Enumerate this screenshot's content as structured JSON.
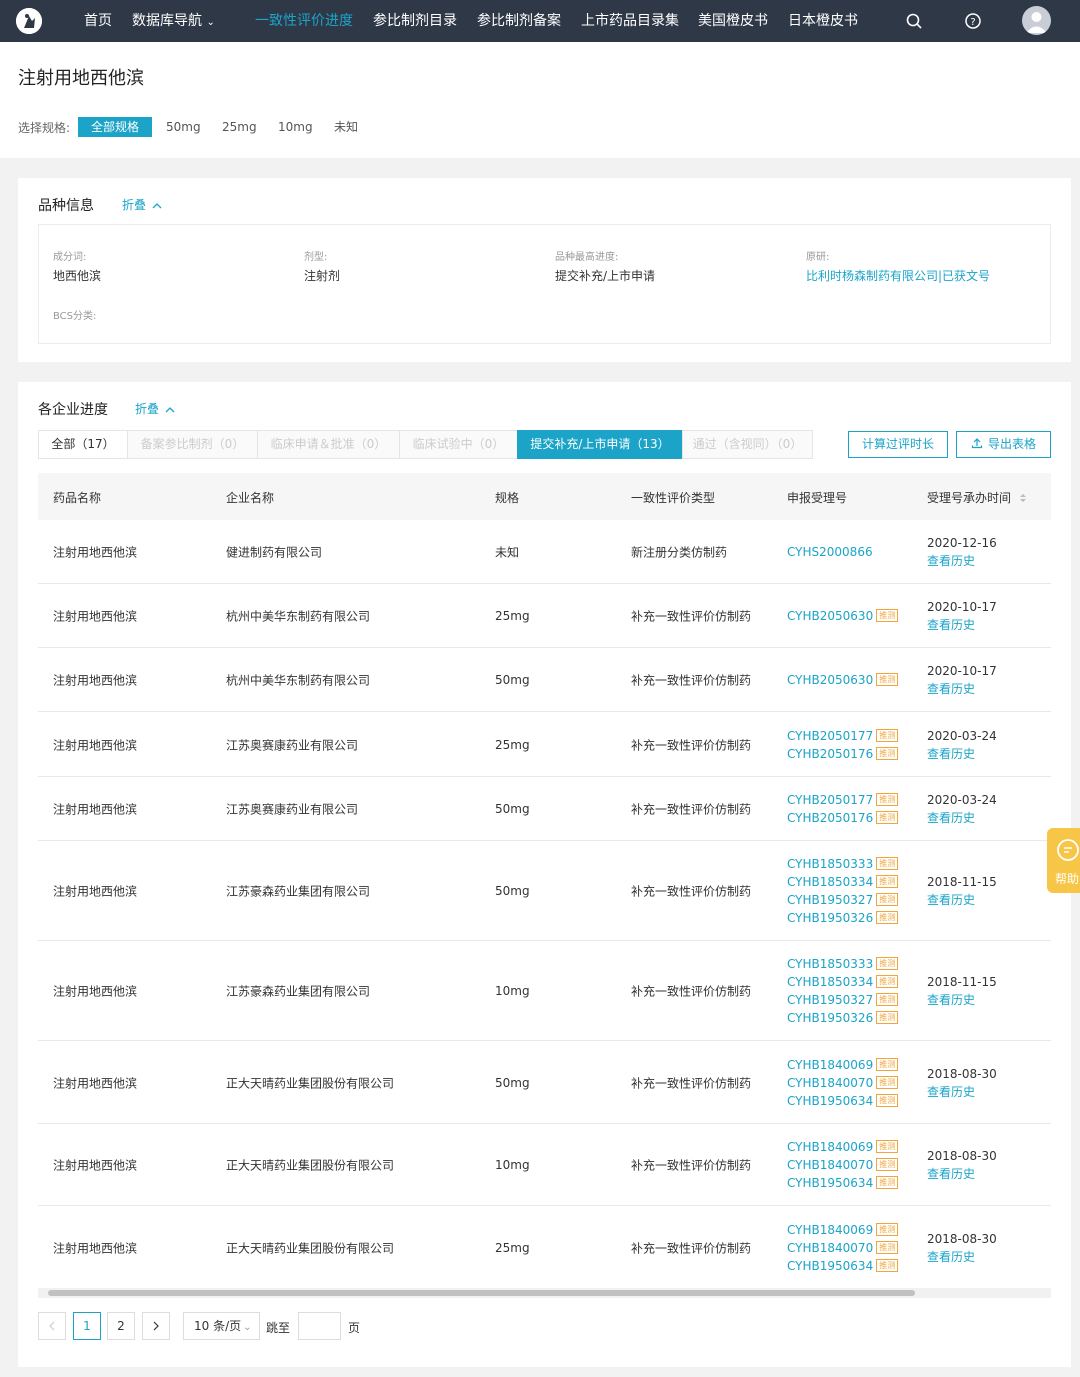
{
  "nav": {
    "items": [
      "首页",
      "数据库导航",
      "一致性评价进度",
      "参比制剂目录",
      "参比制剂备案",
      "上市药品目录集",
      "美国橙皮书",
      "日本橙皮书"
    ],
    "active_index": 2
  },
  "header": {
    "title": "注射用地西他滨",
    "spec_label": "选择规格:",
    "specs": [
      "全部规格",
      "50mg",
      "25mg",
      "10mg",
      "未知"
    ]
  },
  "variety": {
    "title": "品种信息",
    "fold": "折叠",
    "fields": [
      {
        "label": "成分词:",
        "value": "地西他滨"
      },
      {
        "label": "剂型:",
        "value": "注射剂"
      },
      {
        "label": "品种最高进度:",
        "value": "提交补充/上市申请"
      },
      {
        "label": "原研:",
        "value": "比利时杨森制药有限公司|已获文号"
      },
      {
        "label": "BCS分类:",
        "value": ""
      }
    ]
  },
  "progress": {
    "title": "各企业进度",
    "fold": "折叠",
    "tabs": [
      "全部（17）",
      "备案参比制剂（0）",
      "临床申请＆批准（0）",
      "临床试验中（0）",
      "提交补充/上市申请（13）",
      "通过（含视同）（0）"
    ],
    "calc_btn": "计算过评时长",
    "export_btn": "导出表格",
    "columns": [
      "药品名称",
      "企业名称",
      "规格",
      "一致性评价类型",
      "申报受理号",
      "受理号承办时间"
    ],
    "tag": "推测",
    "history": "查看历史",
    "rows": [
      {
        "drug": "注射用地西他滨",
        "company": "健进制药有限公司",
        "spec": "未知",
        "type": "新注册分类仿制药",
        "acc": [
          "CYHS2000866"
        ],
        "tagged": false,
        "date": "2020-12-16"
      },
      {
        "drug": "注射用地西他滨",
        "company": "杭州中美华东制药有限公司",
        "spec": "25mg",
        "type": "补充一致性评价仿制药",
        "acc": [
          "CYHB2050630"
        ],
        "tagged": true,
        "date": "2020-10-17"
      },
      {
        "drug": "注射用地西他滨",
        "company": "杭州中美华东制药有限公司",
        "spec": "50mg",
        "type": "补充一致性评价仿制药",
        "acc": [
          "CYHB2050630"
        ],
        "tagged": true,
        "date": "2020-10-17"
      },
      {
        "drug": "注射用地西他滨",
        "company": "江苏奥赛康药业有限公司",
        "spec": "25mg",
        "type": "补充一致性评价仿制药",
        "acc": [
          "CYHB2050177",
          "CYHB2050176"
        ],
        "tagged": true,
        "date": "2020-03-24"
      },
      {
        "drug": "注射用地西他滨",
        "company": "江苏奥赛康药业有限公司",
        "spec": "50mg",
        "type": "补充一致性评价仿制药",
        "acc": [
          "CYHB2050177",
          "CYHB2050176"
        ],
        "tagged": true,
        "date": "2020-03-24"
      },
      {
        "drug": "注射用地西他滨",
        "company": "江苏豪森药业集团有限公司",
        "spec": "50mg",
        "type": "补充一致性评价仿制药",
        "acc": [
          "CYHB1850333",
          "CYHB1850334",
          "CYHB1950327",
          "CYHB1950326"
        ],
        "tagged": true,
        "date": "2018-11-15"
      },
      {
        "drug": "注射用地西他滨",
        "company": "江苏豪森药业集团有限公司",
        "spec": "10mg",
        "type": "补充一致性评价仿制药",
        "acc": [
          "CYHB1850333",
          "CYHB1850334",
          "CYHB1950327",
          "CYHB1950326"
        ],
        "tagged": true,
        "date": "2018-11-15"
      },
      {
        "drug": "注射用地西他滨",
        "company": "正大天晴药业集团股份有限公司",
        "spec": "50mg",
        "type": "补充一致性评价仿制药",
        "acc": [
          "CYHB1840069",
          "CYHB1840070",
          "CYHB1950634"
        ],
        "tagged": true,
        "date": "2018-08-30"
      },
      {
        "drug": "注射用地西他滨",
        "company": "正大天晴药业集团股份有限公司",
        "spec": "10mg",
        "type": "补充一致性评价仿制药",
        "acc": [
          "CYHB1840069",
          "CYHB1840070",
          "CYHB1950634"
        ],
        "tagged": true,
        "date": "2018-08-30"
      },
      {
        "drug": "注射用地西他滨",
        "company": "正大天晴药业集团股份有限公司",
        "spec": "25mg",
        "type": "补充一致性评价仿制药",
        "acc": [
          "CYHB1840069",
          "CYHB1840070",
          "CYHB1950634"
        ],
        "tagged": true,
        "date": "2018-08-30"
      }
    ]
  },
  "pagination": {
    "pages": [
      "1",
      "2"
    ],
    "current": "1",
    "page_size": "10 条/页",
    "jump_label": "跳至",
    "page_suffix": "页"
  },
  "help": {
    "label": "帮助"
  },
  "colors": {
    "nav_bg": "#2f3847",
    "accent": "#1ba4c8",
    "tag": "#f0a63c",
    "help": "#f7c647"
  }
}
